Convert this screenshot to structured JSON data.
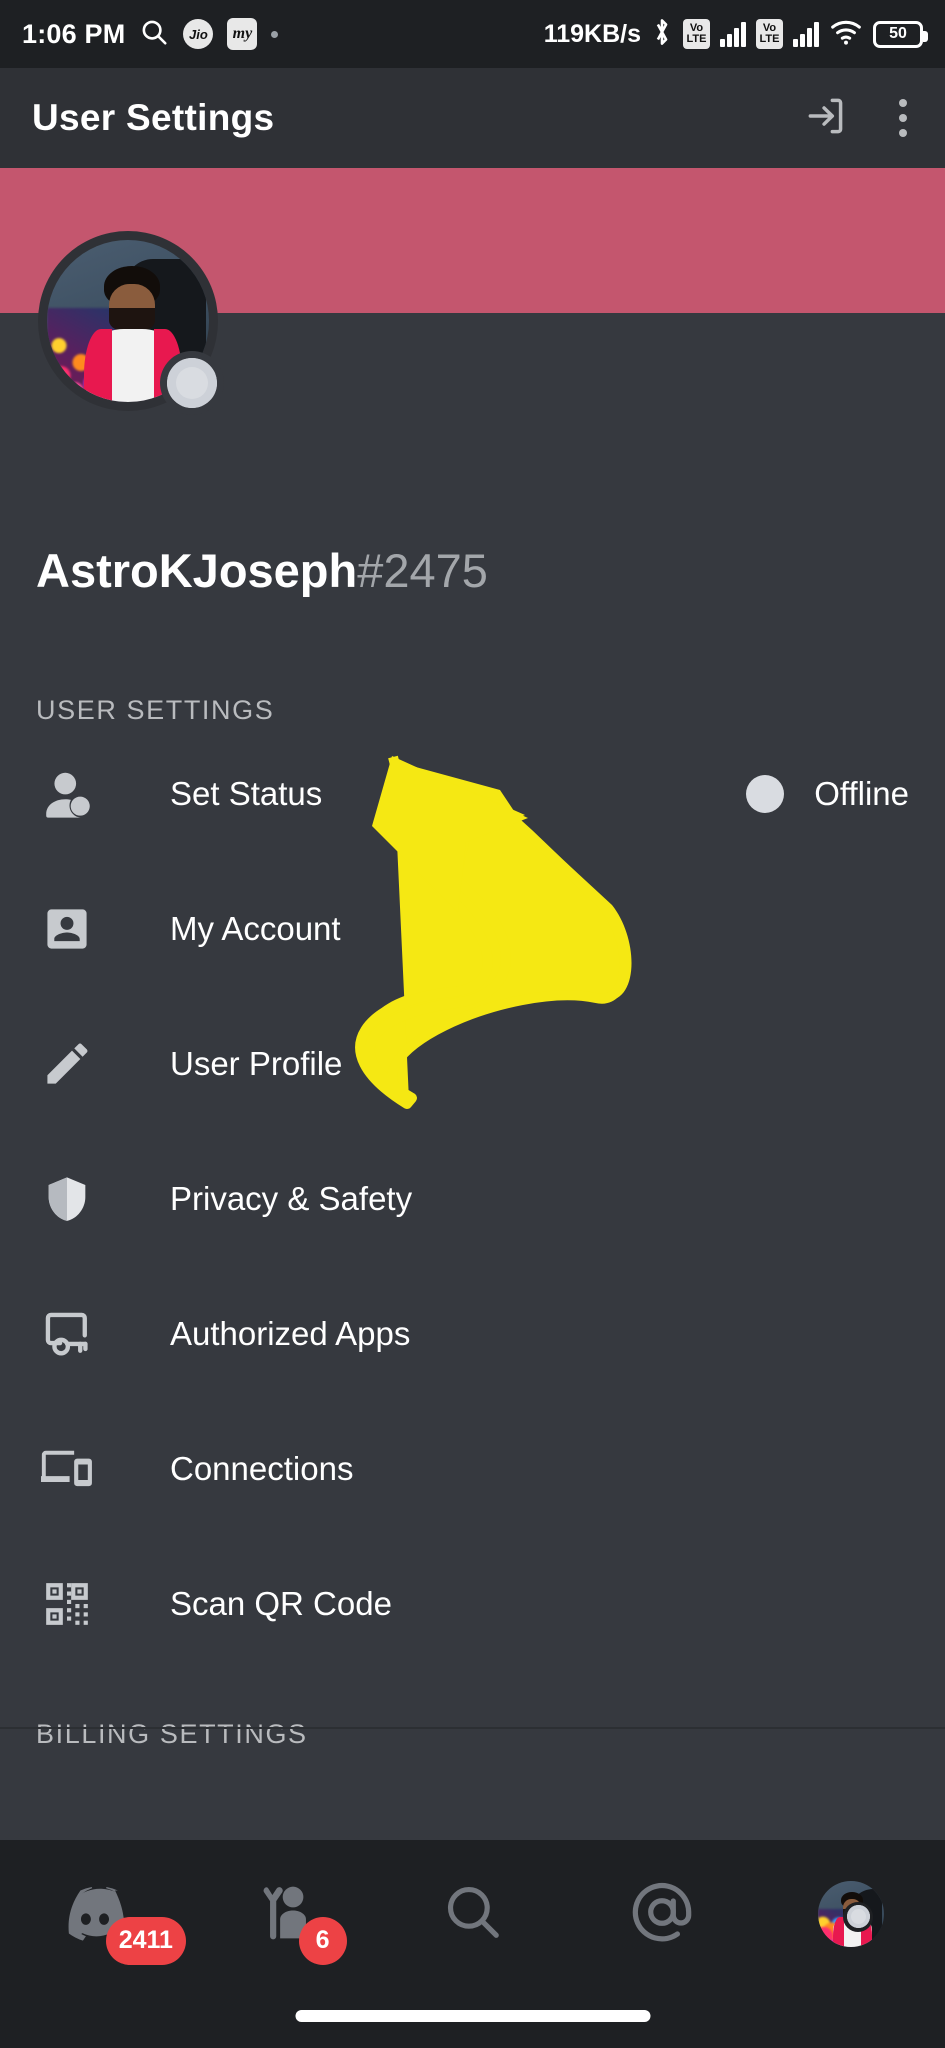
{
  "status_bar": {
    "time": "1:06 PM",
    "search_icon": "search-icon",
    "carrier_badges": [
      "Jio",
      "my"
    ],
    "notification_dot": "•",
    "network_speed": "119KB/s",
    "bluetooth_icon": "bluetooth-icon",
    "sim1_volte": "VoLTE",
    "sim2_volte": "VoLTE",
    "wifi_icon": "wifi-icon",
    "battery_level": "50"
  },
  "header": {
    "title": "User Settings",
    "logout_icon": "logout-icon",
    "overflow_icon": "overflow-menu-icon"
  },
  "profile": {
    "banner_color": "#C4566E",
    "username": "AstroKJoseph",
    "discriminator": "#2475",
    "avatar_status": "offline"
  },
  "sections": [
    {
      "heading": "USER SETTINGS",
      "items": [
        {
          "label": "Set Status",
          "icon": "set-status-icon",
          "trailing_text": "Offline",
          "trailing_dot_color": "#D9DCE1"
        },
        {
          "label": "My Account",
          "icon": "account-box-icon"
        },
        {
          "label": "User Profile",
          "icon": "pencil-icon"
        },
        {
          "label": "Privacy & Safety",
          "icon": "shield-icon"
        },
        {
          "label": "Authorized Apps",
          "icon": "authorized-apps-icon"
        },
        {
          "label": "Connections",
          "icon": "devices-icon"
        },
        {
          "label": "Scan QR Code",
          "icon": "qr-code-icon"
        }
      ]
    },
    {
      "heading": "BILLING SETTINGS",
      "items": []
    }
  ],
  "bottom_nav": [
    {
      "name": "home",
      "icon": "discord-home-icon",
      "badge": "2411"
    },
    {
      "name": "friends",
      "icon": "friends-icon",
      "badge": "6"
    },
    {
      "name": "search",
      "icon": "search-icon",
      "badge": ""
    },
    {
      "name": "mentions",
      "icon": "mentions-at-icon",
      "badge": ""
    },
    {
      "name": "profile",
      "icon": "profile-avatar-icon",
      "badge": ""
    }
  ],
  "annotation": {
    "arrow_color": "#F5E813",
    "arrow_points_to": "My Account"
  }
}
